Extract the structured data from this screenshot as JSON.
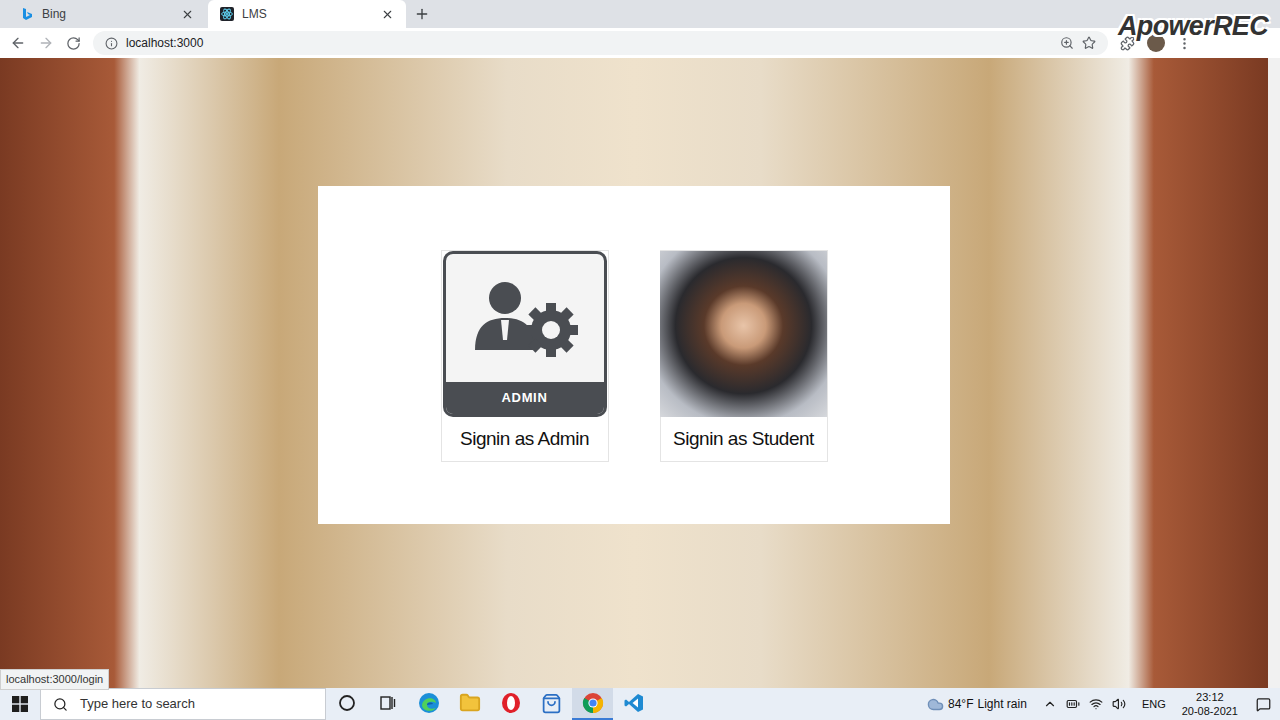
{
  "browser": {
    "tabs": [
      {
        "label": "Bing",
        "selected": false,
        "kind": "bing"
      },
      {
        "label": "LMS",
        "selected": true,
        "kind": "react"
      }
    ],
    "address": "localhost:3000",
    "status_url": "localhost:3000/login"
  },
  "watermark": "ApowerREC",
  "page": {
    "options": [
      {
        "label": "Signin as Admin",
        "kind": "admin",
        "badge": "ADMIN"
      },
      {
        "label": "Signin as Student",
        "kind": "student",
        "badge": ""
      }
    ]
  },
  "taskbar": {
    "search_placeholder": "Type here to search",
    "apps": [
      {
        "kind": "cortana",
        "selected": false
      },
      {
        "kind": "taskview",
        "selected": false
      },
      {
        "kind": "edge",
        "selected": false
      },
      {
        "kind": "explorer",
        "selected": false
      },
      {
        "kind": "opera",
        "selected": false
      },
      {
        "kind": "store",
        "selected": false
      },
      {
        "kind": "chrome",
        "selected": true
      },
      {
        "kind": "vscode",
        "selected": false
      }
    ],
    "weather": {
      "temp": "84°F",
      "text": "Light rain"
    },
    "language": "ENG",
    "time": "23:12",
    "date": "20-08-2021"
  }
}
